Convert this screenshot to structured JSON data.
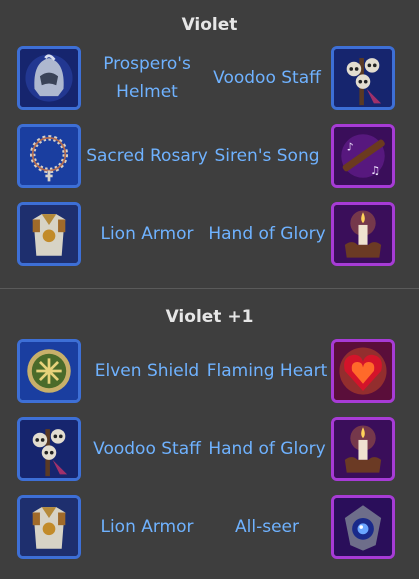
{
  "sections": [
    {
      "title": "Violet",
      "rows": [
        {
          "left": {
            "name": "Prospero's Helmet",
            "icon": "helmet-icon"
          },
          "right": {
            "name": "Voodoo Staff",
            "icon": "skulls-staff-icon"
          }
        },
        {
          "left": {
            "name": "Sacred Rosary",
            "icon": "rosary-icon"
          },
          "right": {
            "name": "Siren's Song",
            "icon": "flute-icon"
          }
        },
        {
          "left": {
            "name": "Lion Armor",
            "icon": "armor-icon"
          },
          "right": {
            "name": "Hand of Glory",
            "icon": "candle-hand-icon"
          }
        }
      ]
    },
    {
      "title": "Violet +1",
      "rows": [
        {
          "left": {
            "name": "Elven Shield",
            "icon": "round-shield-icon"
          },
          "right": {
            "name": "Flaming Heart",
            "icon": "flaming-heart-icon"
          }
        },
        {
          "left": {
            "name": "Voodoo Staff",
            "icon": "skulls-staff-icon"
          },
          "right": {
            "name": "Hand of Glory",
            "icon": "candle-hand-icon"
          }
        },
        {
          "left": {
            "name": "Lion Armor",
            "icon": "armor-icon"
          },
          "right": {
            "name": "All-seer",
            "icon": "eye-orb-icon"
          }
        }
      ]
    }
  ],
  "colors": {
    "background": "#3e3e3e",
    "label": "#6fb2ff",
    "title": "#e6e6e6",
    "blue_frame": "#3d6fd6",
    "purple_frame": "#a73bd6"
  }
}
